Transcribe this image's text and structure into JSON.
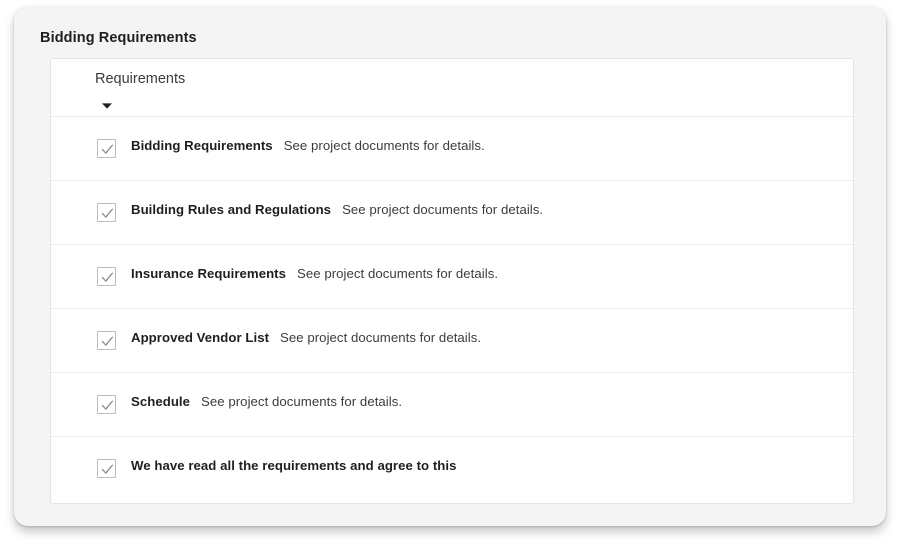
{
  "page": {
    "title": "Bidding Requirements"
  },
  "card": {
    "group_title": "Requirements",
    "collapse_icon": "chevron-down-icon",
    "checkbox_icon": "checkmark-icon",
    "rows": [
      {
        "label": "Bidding Requirements",
        "description": "See project documents for details.",
        "checked": true
      },
      {
        "label": "Building Rules and Regulations",
        "description": "See project documents for details.",
        "checked": true
      },
      {
        "label": "Insurance Requirements",
        "description": "See project documents for details.",
        "checked": true
      },
      {
        "label": "Approved Vendor List",
        "description": "See project documents for details.",
        "checked": true
      },
      {
        "label": "Schedule",
        "description": "See project documents for details.",
        "checked": true
      },
      {
        "label": "We have read all the requirements and agree to this",
        "description": "",
        "checked": true
      }
    ]
  },
  "colors": {
    "page_background": "#ffffff",
    "panel_background": "#f4f4f5",
    "card_background": "#ffffff",
    "card_border": "#e2e4e8",
    "row_divider": "#edf0f5",
    "title_text": "#1f1f22",
    "body_text": "#3c3c41",
    "checkbox_border": "#bcbcc0",
    "checkmark": "#8a8a90"
  }
}
